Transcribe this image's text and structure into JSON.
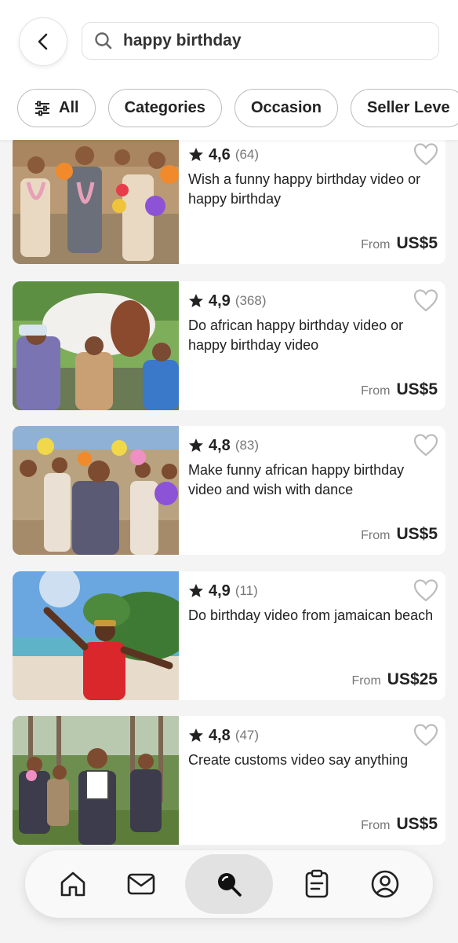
{
  "search": {
    "query": "happy birthday"
  },
  "filters": [
    {
      "label": "All"
    },
    {
      "label": "Categories"
    },
    {
      "label": "Occasion"
    },
    {
      "label": "Seller Leve"
    }
  ],
  "results": [
    {
      "rating": "4,6",
      "count": "(64)",
      "title": "Wish a funny happy birthday video or happy birthday",
      "from": "From",
      "price": "US$5"
    },
    {
      "rating": "4,9",
      "count": "(368)",
      "title": "Do african happy birthday video or happy birthday video",
      "from": "From",
      "price": "US$5"
    },
    {
      "rating": "4,8",
      "count": "(83)",
      "title": "Make funny african happy birthday video and wish with dance",
      "from": "From",
      "price": "US$5"
    },
    {
      "rating": "4,9",
      "count": "(11)",
      "title": "Do birthday video from jamaican beach",
      "from": "From",
      "price": "US$25"
    },
    {
      "rating": "4,8",
      "count": "(47)",
      "title": "Create customs video say anything",
      "from": "From",
      "price": "US$5"
    }
  ],
  "tabbar": {
    "items": [
      "home-icon",
      "inbox-icon",
      "search-icon",
      "orders-icon",
      "profile-icon"
    ],
    "active": "search-icon"
  },
  "colors": {
    "background": "#f4f4f4",
    "card": "#ffffff",
    "active_tab": "#e2e2e2"
  }
}
